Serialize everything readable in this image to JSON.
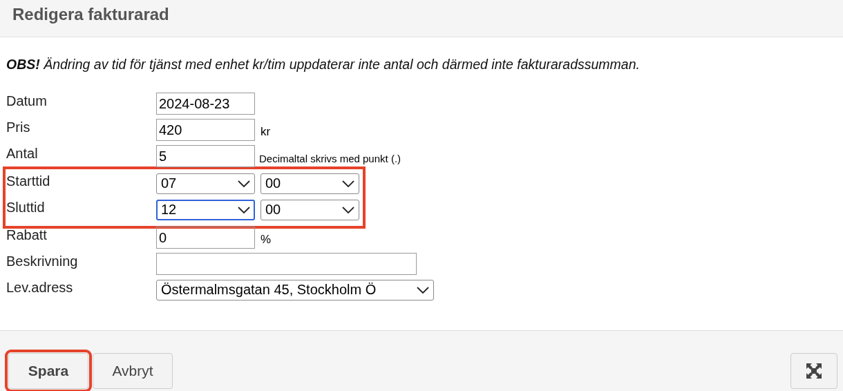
{
  "dialog": {
    "title": "Redigera fakturarad"
  },
  "notice": "**OBS!** Ändring av tid för tjänst med enhet kr/tim uppdaterar inte antal och därmed inte fakturaradssumman.",
  "fields": [
    {
      "label": "Datum",
      "kind": "short",
      "value": "2024-08-23",
      "highlighted": false
    },
    {
      "label": "Pris",
      "kind": "short",
      "value": "420",
      "suffix": "kr",
      "highlighted": false
    },
    {
      "label": "Antal",
      "kind": "short",
      "value": "5",
      "hint": "Decimaltal skrivs med punkt (.)",
      "highlighted": false
    },
    {
      "label": "Starttid",
      "kind": "time",
      "hour": "07",
      "minute": "00",
      "focused": false,
      "highlighted": true
    },
    {
      "label": "Sluttid",
      "kind": "time",
      "hour": "12",
      "minute": "00",
      "focused": true,
      "highlighted": true
    },
    {
      "label": "Rabatt",
      "kind": "short",
      "value": "0",
      "suffix": "%",
      "highlighted": false
    },
    {
      "label": "Beskrivning",
      "kind": "wide",
      "highlighted": false
    },
    {
      "label": "Lev.adress",
      "kind": "select",
      "value": "Östermalmsgatan 45, Stockholm Ö",
      "highlighted": false
    }
  ],
  "buttons": [
    {
      "label": "Spara",
      "primary": true,
      "highlighted": true
    },
    {
      "label": "Avbryt",
      "primary": false,
      "highlighted": false
    }
  ]
}
